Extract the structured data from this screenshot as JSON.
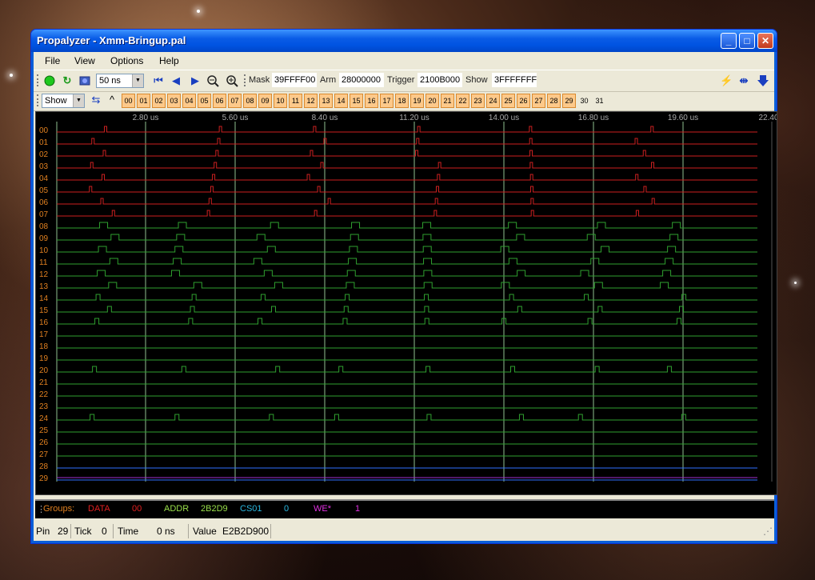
{
  "window": {
    "title": "Propalyzer - Xmm-Bringup.pal",
    "minimize": "_",
    "maximize": "□",
    "close": "✕"
  },
  "menu": [
    "File",
    "View",
    "Options",
    "Help"
  ],
  "toolbar": {
    "timebase": "50 ns",
    "mask_label": "Mask",
    "mask_value": "39FFFF00",
    "arm_label": "Arm",
    "arm_value": "28000000",
    "trigger_label": "Trigger",
    "trigger_value": "2100B000",
    "show_label": "Show",
    "show_value": "3FFFFFFF"
  },
  "toolbar2": {
    "show_combo": "Show",
    "pins": [
      "00",
      "01",
      "02",
      "03",
      "04",
      "05",
      "06",
      "07",
      "08",
      "09",
      "10",
      "11",
      "12",
      "13",
      "14",
      "15",
      "16",
      "17",
      "18",
      "19",
      "20",
      "21",
      "22",
      "23",
      "24",
      "25",
      "26",
      "27",
      "28",
      "29",
      "30",
      "31"
    ],
    "pins_active_count": 30
  },
  "scope": {
    "time_labels": [
      "2.80 us",
      "5.60 us",
      "8.40 us",
      "11.20 us",
      "14.00 us",
      "16.80 us",
      "19.60 us",
      "22.40"
    ],
    "channels": [
      "00",
      "01",
      "02",
      "03",
      "04",
      "05",
      "06",
      "07",
      "08",
      "09",
      "10",
      "11",
      "12",
      "13",
      "14",
      "15",
      "16",
      "17",
      "18",
      "19",
      "20",
      "21",
      "22",
      "23",
      "24",
      "25",
      "26",
      "27",
      "28",
      "29"
    ],
    "colors": {
      "red": "#cc2020",
      "green": "#2fa02f",
      "grid": "#8fbf8f",
      "label": "#e08020"
    }
  },
  "groups": {
    "label": "Groups:",
    "items": [
      {
        "name": "DATA",
        "value": "00",
        "color": "#e02020"
      },
      {
        "name": "ADDR",
        "value": "2B2D9",
        "color": "#9ae04a"
      },
      {
        "name": "CS01",
        "value": "0",
        "color": "#2ab8e0"
      },
      {
        "name": "WE*",
        "value": "1",
        "color": "#e030e0"
      }
    ]
  },
  "status": {
    "pin_label": "Pin",
    "pin_value": "29",
    "tick_label": "Tick",
    "tick_value": "0",
    "time_label": "Time",
    "time_value": "0 ns",
    "value_label": "Value",
    "value_value": "E2B2D900"
  }
}
